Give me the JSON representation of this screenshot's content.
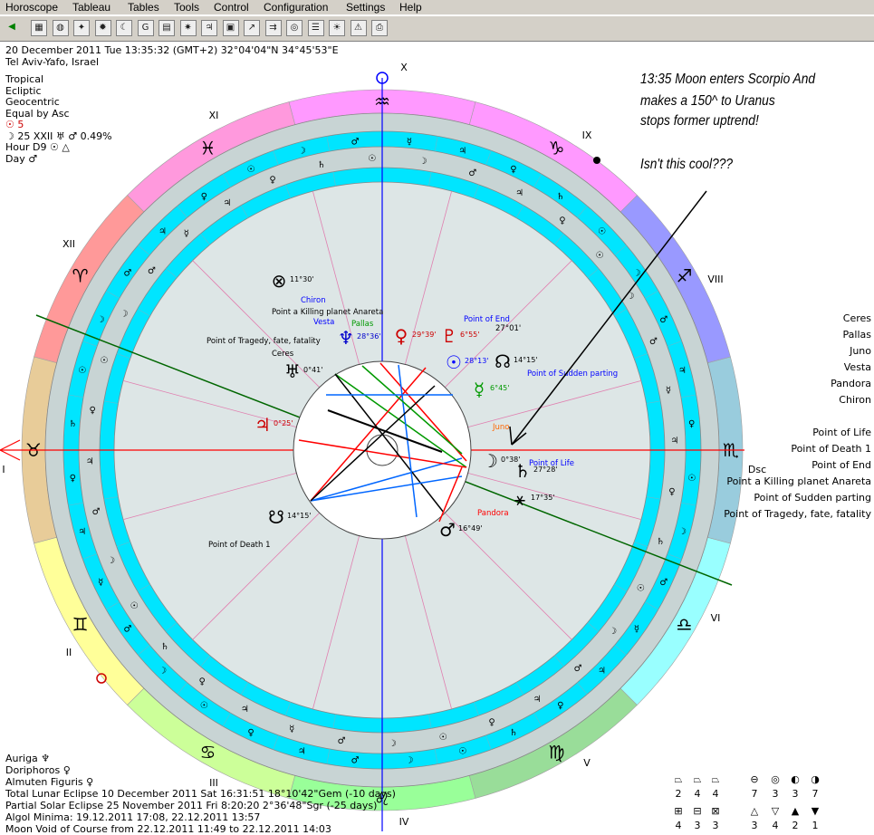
{
  "menu": [
    "Horoscope",
    "Tableau",
    "Tables",
    "Tools",
    "Control",
    "Configuration",
    "Settings",
    "Help"
  ],
  "toolbar_icons": [
    "back-arrow-icon",
    "grid-icon",
    "globe-icon",
    "aspect-icon",
    "stars-icon",
    "moon-icon",
    "google-icon",
    "table-icon",
    "star-chart-icon",
    "planets-icon",
    "calendar-icon",
    "transit-icon",
    "direction-icon",
    "wheel-icon",
    "list-icon",
    "sun-icon",
    "warning-icon",
    "print-icon"
  ],
  "header": {
    "line1": "20 December 2011  Tue  13:35:32 (GMT+2) 32°04'04\"N  34°45'53\"E",
    "line2": "Tel Aviv-Yafo, Israel"
  },
  "settings": [
    "Tropical",
    "Ecliptic",
    "Geocentric",
    "Equal by Asc",
    "☉ 5",
    "☽ 25 XXII ♅ ♂ 0.49%",
    "Hour D9 ☉ △",
    "Day ♂"
  ],
  "annotation": [
    "13:35 Moon enters Scorpio And",
    "makes a 150^ to Uranus",
    "stops former uptrend!",
    "",
    "Isn't this cool???"
  ],
  "right_list": [
    "Ceres",
    "Pallas",
    "Juno",
    "Vesta",
    "Pandora",
    "Chiron",
    "",
    "Point of Life",
    "Point of Death 1",
    "Point of End",
    "Point a Killing planet Anareta",
    "Point of Sudden parting",
    "Point of Tragedy, fate, fatality"
  ],
  "bottom_info": [
    "Auriga  ♆",
    "Doriphoros  ♀",
    "Almuten Figuris  ♀",
    "Total Lunar Eclipse 10 December 2011 Sat 16:31:51 18°10'42\"Gem (-10 days)",
    "Partial Solar Eclipse 25 November 2011 Fri  8:20:20  2°36'48\"Sgr (-25 days)",
    "Algol Minima: 19.12.2011 17:08,  22.12.2011 13:57",
    "Moon Void of Course from 22.12.2011 11:49 to 22.12.2011 14:03"
  ],
  "aspect_counts": [
    {
      "symbol": "⏢",
      "count": "2"
    },
    {
      "symbol": "⏢",
      "count": "4"
    },
    {
      "symbol": "⏢",
      "count": "4"
    },
    {
      "symbol": "⊖",
      "count": "7"
    },
    {
      "symbol": "◎",
      "count": "3"
    },
    {
      "symbol": "◐",
      "count": "3"
    },
    {
      "symbol": "◑",
      "count": "7"
    },
    {
      "symbol": "⊞",
      "count": "4"
    },
    {
      "symbol": "⊟",
      "count": "3"
    },
    {
      "symbol": "⊠",
      "count": "3"
    },
    {
      "symbol": "△",
      "count": "3"
    },
    {
      "symbol": "▽",
      "count": "4"
    },
    {
      "symbol": "▲",
      "count": "2"
    },
    {
      "symbol": "▼",
      "count": "1"
    }
  ],
  "house_labels": [
    "X",
    "XI",
    "XII",
    "I",
    "II",
    "III",
    "IV",
    "V",
    "VI",
    "Dsc",
    "VIII",
    "IX"
  ],
  "signs": [
    {
      "glyph": "♒",
      "angle": 270,
      "color": "#ff99ff"
    },
    {
      "glyph": "♓",
      "angle": 240,
      "color": "#ff99dd"
    },
    {
      "glyph": "♈",
      "angle": 210,
      "color": "#ff9999"
    },
    {
      "glyph": "♉",
      "angle": 180,
      "color": "#e8cc99"
    },
    {
      "glyph": "♊",
      "angle": 150,
      "color": "#ffff99"
    },
    {
      "glyph": "♋",
      "angle": 120,
      "color": "#ccff99"
    },
    {
      "glyph": "♌",
      "angle": 90,
      "color": "#99ff99"
    },
    {
      "glyph": "♍",
      "angle": 60,
      "color": "#99dd99"
    },
    {
      "glyph": "♎",
      "angle": 30,
      "color": "#99ffff"
    },
    {
      "glyph": "♏",
      "angle": 0,
      "color": "#99ccdd"
    },
    {
      "glyph": "♐",
      "angle": 330,
      "color": "#9999ff"
    },
    {
      "glyph": "♑",
      "angle": 300,
      "color": "#ff99ff"
    }
  ],
  "planets": [
    {
      "glyph": "♆",
      "label": "28°36'",
      "color": "#0000cc"
    },
    {
      "glyph": "♀",
      "label": "29°39'",
      "color": "#cc0000"
    },
    {
      "glyph": "♇",
      "label": "6°55'",
      "color": "#cc0000"
    },
    {
      "glyph": "☉",
      "label": "28°13'",
      "color": "#0000ff"
    },
    {
      "glyph": "☊",
      "label": "14°15'",
      "color": "#000000"
    },
    {
      "glyph": "☿",
      "label": "6°45'",
      "color": "#009900"
    },
    {
      "glyph": "♅",
      "label": "0°41'",
      "color": "#000000"
    },
    {
      "glyph": "♃",
      "label": "0°25'",
      "color": "#cc0000"
    },
    {
      "glyph": "☽",
      "label": "0°38'",
      "color": "#000000"
    },
    {
      "glyph": "♄",
      "label": "27°28'",
      "color": "#000000"
    },
    {
      "glyph": "⚹",
      "label": "17°35'",
      "color": "#000000"
    },
    {
      "glyph": "☋",
      "label": "14°15'",
      "color": "#000000"
    },
    {
      "glyph": "♂",
      "label": "16°49'",
      "color": "#000000"
    },
    {
      "glyph": "⊗",
      "label": "11°30'",
      "color": "#000000"
    }
  ],
  "points": [
    "Chiron",
    "Point a Killing planet Anareta",
    "Vesta",
    "Pallas",
    "Point of Tragedy, fate, fatality",
    "Ceres",
    "Point of End",
    "Point of Sudden parting",
    "Juno",
    "Point of Life",
    "Pandora",
    "Point of Death 1",
    "27°01'"
  ],
  "colors": {
    "cyan": "#00e5ff",
    "inner_bg": "#dde6e6",
    "red_axis": "#ff0000",
    "blue_axis": "#0000ff",
    "green_line": "#006600"
  }
}
